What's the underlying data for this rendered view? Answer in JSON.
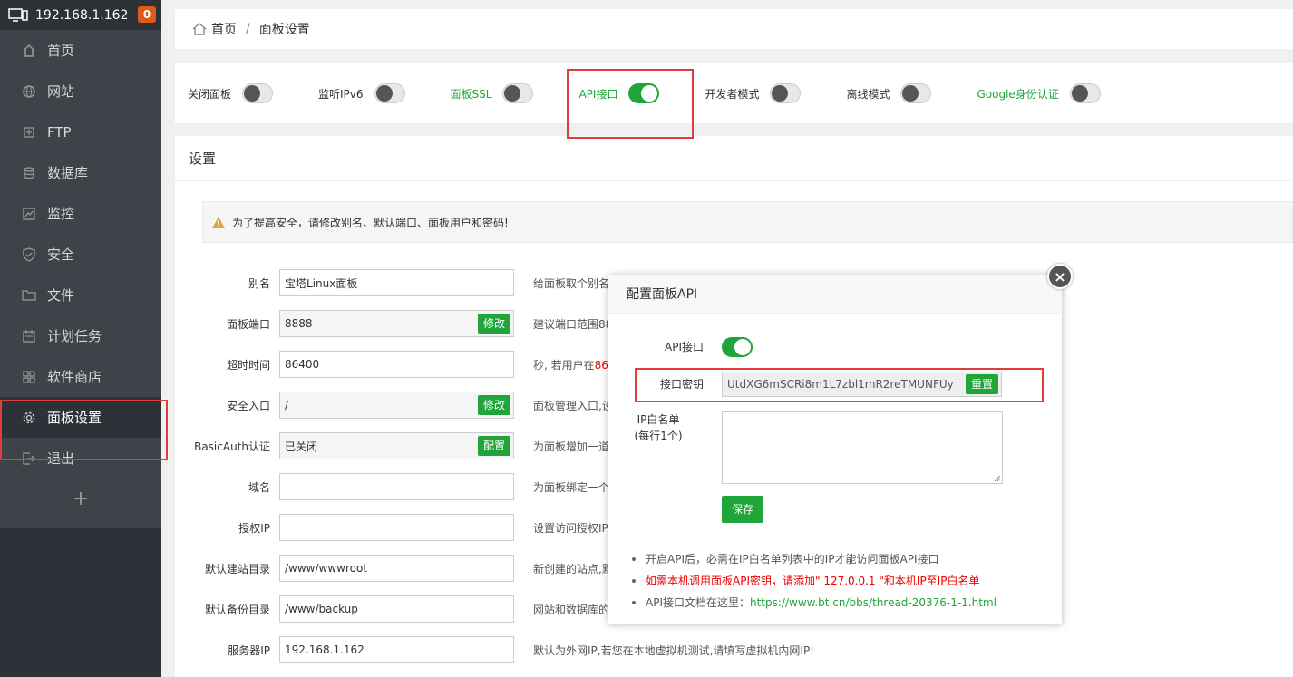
{
  "sidebar": {
    "ip": "192.168.1.162",
    "badge": "0",
    "items": [
      {
        "label": "首页",
        "icon": "home-icon"
      },
      {
        "label": "网站",
        "icon": "globe-icon"
      },
      {
        "label": "FTP",
        "icon": "ftp-icon"
      },
      {
        "label": "数据库",
        "icon": "database-icon"
      },
      {
        "label": "监控",
        "icon": "monitor-icon"
      },
      {
        "label": "安全",
        "icon": "shield-icon"
      },
      {
        "label": "文件",
        "icon": "folder-icon"
      },
      {
        "label": "计划任务",
        "icon": "calendar-icon"
      },
      {
        "label": "软件商店",
        "icon": "apps-icon"
      },
      {
        "label": "面板设置",
        "icon": "gear-icon"
      },
      {
        "label": "退出",
        "icon": "logout-icon"
      }
    ],
    "add": "+"
  },
  "breadcrumb": {
    "home": "首页",
    "sep": "/",
    "current": "面板设置"
  },
  "switches": [
    {
      "label": "关闭面板",
      "on": false,
      "green": false
    },
    {
      "label": "监听IPv6",
      "on": false,
      "green": false
    },
    {
      "label": "面板SSL",
      "on": false,
      "green": true
    },
    {
      "label": "API接口",
      "on": true,
      "green": true
    },
    {
      "label": "开发者模式",
      "on": false,
      "green": false
    },
    {
      "label": "离线模式",
      "on": false,
      "green": false
    },
    {
      "label": "Google身份认证",
      "on": false,
      "green": true
    }
  ],
  "settings": {
    "title": "设置",
    "warning": "为了提高安全，请修改别名、默认端口、面板用户和密码!",
    "rows": [
      {
        "label": "别名",
        "value": "宝塔Linux面板",
        "button": "",
        "hint": "给面板取个别名"
      },
      {
        "label": "面板端口",
        "value": "8888",
        "button": "修改",
        "hint": "建议端口范围88"
      },
      {
        "label": "超时时间",
        "value": "86400",
        "button": "",
        "hint": "秒, 若用户在",
        "hint_red": "86"
      },
      {
        "label": "安全入口",
        "value": "/",
        "button": "修改",
        "hint": "面板管理入口,设"
      },
      {
        "label": "BasicAuth认证",
        "value": "已关闭",
        "button": "配置",
        "hint": "为面板增加一道"
      },
      {
        "label": "域名",
        "value": "",
        "button": "",
        "hint": "为面板绑定一个"
      },
      {
        "label": "授权IP",
        "value": "",
        "button": "",
        "hint": "设置访问授权IP"
      },
      {
        "label": "默认建站目录",
        "value": "/www/wwwroot",
        "button": "",
        "hint": "新创建的站点,默"
      },
      {
        "label": "默认备份目录",
        "value": "/www/backup",
        "button": "",
        "hint": "网站和数据库的"
      },
      {
        "label": "服务器IP",
        "value": "192.168.1.162",
        "button": "",
        "hint": "默认为外网IP,若您在本地虚拟机测试,请填写虚拟机内网IP!"
      }
    ]
  },
  "modal": {
    "title": "配置面板API",
    "close": "×",
    "api_label": "API接口",
    "api_on": true,
    "key_label": "接口密钥",
    "key_value": "UtdXG6mSCRi8m1L7zbl1mR2reTMUNFUy",
    "reset_label": "重置",
    "whitelist_label": "IP白名单",
    "whitelist_sub": "(每行1个)",
    "save_label": "保存",
    "notes": [
      "开启API后，必需在IP白名单列表中的IP才能访问面板API接口",
      "如需本机调用面板API密钥，请添加\" 127.0.0.1 \"和本机IP至IP白名单"
    ],
    "doc_prefix": "API接口文档在这里：",
    "doc_link": "https://www.bt.cn/bbs/thread-20376-1-1.html"
  }
}
